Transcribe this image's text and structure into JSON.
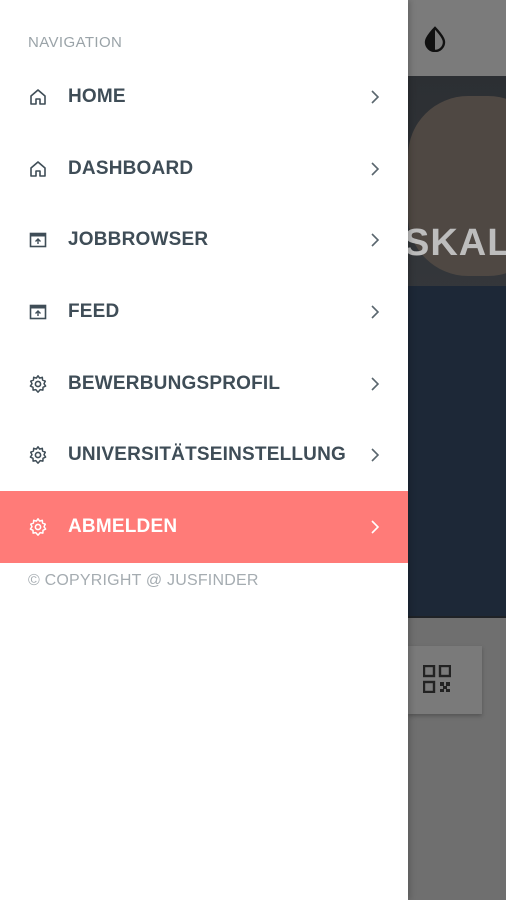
{
  "drawer": {
    "heading": "NAVIGATION",
    "items": [
      {
        "label": "HOME",
        "icon": "home-icon",
        "active": false
      },
      {
        "label": "DASHBOARD",
        "icon": "home-icon",
        "active": false
      },
      {
        "label": "JOBBROWSER",
        "icon": "browser-icon",
        "active": false
      },
      {
        "label": "FEED",
        "icon": "browser-icon",
        "active": false
      },
      {
        "label": "BEWERBUNGSPROFIL",
        "icon": "gear-icon",
        "active": false
      },
      {
        "label": "UNIVERSITÄTSEINSTELLUNG",
        "icon": "gear-icon",
        "active": false
      },
      {
        "label": "ABMELDEN",
        "icon": "gear-icon",
        "active": true
      }
    ],
    "copyright": "© COPYRIGHT @ JUSFINDER"
  },
  "background": {
    "hero_text": "SKALE",
    "theme_toggle_icon": "contrast-icon",
    "qr_icon": "qr-code-icon"
  },
  "colors": {
    "active": "#ff7b78",
    "label": "#3f4d57",
    "muted": "#9aa3a8"
  }
}
